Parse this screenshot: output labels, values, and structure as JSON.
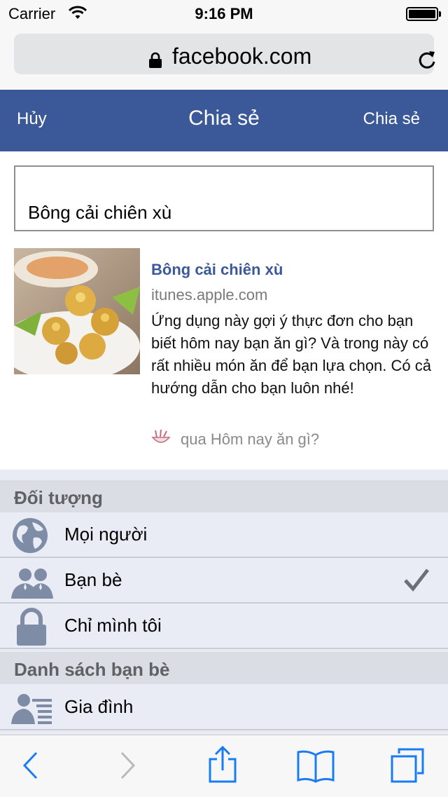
{
  "status_bar": {
    "carrier": "Carrier",
    "time": "9:16 PM"
  },
  "browser": {
    "url": "facebook.com"
  },
  "header": {
    "cancel_label": "Hủy",
    "title": "Chia sẻ",
    "share_label": "Chia sẻ",
    "color": "#3b5998"
  },
  "message": {
    "text": "Bông cải chiên xù"
  },
  "link_preview": {
    "title": "Bông cải chiên xù",
    "domain": "itunes.apple.com",
    "description": "Ứng dụng này gợi ý thực đơn cho bạn biết hôm nay bạn ăn gì? Và trong này có rất nhiều món ăn để bạn lựa chọn. Có cả hướng dẫn cho bạn luôn nhé!",
    "via": "qua Hôm nay ăn gì?"
  },
  "audience": {
    "section_label": "Đối tượng",
    "options": [
      {
        "label": "Mọi người",
        "icon": "globe-icon",
        "selected": false
      },
      {
        "label": "Bạn bè",
        "icon": "friends-icon",
        "selected": true
      },
      {
        "label": "Chỉ mình tôi",
        "icon": "lock-icon",
        "selected": false
      }
    ]
  },
  "friend_lists": {
    "section_label": "Danh sách bạn bè",
    "items": [
      {
        "label": "Gia đình",
        "icon": "friend-list-icon"
      }
    ]
  },
  "toolbar": {
    "icons": [
      "back-icon",
      "forward-icon",
      "share-icon",
      "bookmarks-icon",
      "tabs-icon"
    ],
    "accent": "#1a7cf5"
  }
}
